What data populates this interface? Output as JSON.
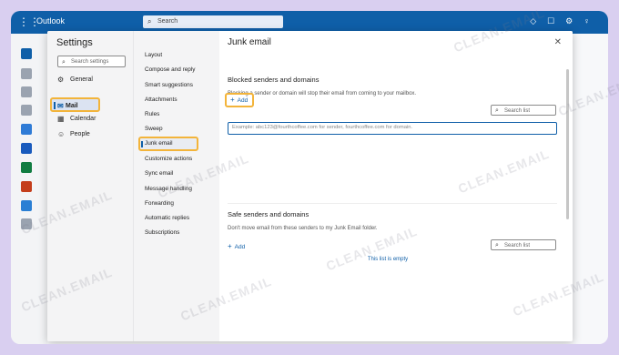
{
  "app": {
    "name": "Outlook",
    "search_placeholder": "Search"
  },
  "settings": {
    "title": "Settings",
    "search_placeholder": "Search settings",
    "categories": [
      {
        "label": "General",
        "icon": "gear-icon"
      },
      {
        "label": "Mail",
        "icon": "mail-icon"
      },
      {
        "label": "Calendar",
        "icon": "calendar-icon"
      },
      {
        "label": "People",
        "icon": "people-icon"
      }
    ],
    "selected_category": "Mail",
    "subcategories": [
      "Layout",
      "Compose and reply",
      "Smart suggestions",
      "Attachments",
      "Rules",
      "Sweep",
      "Junk email",
      "Customize actions",
      "Sync email",
      "Message handling",
      "Forwarding",
      "Automatic replies",
      "Subscriptions"
    ],
    "selected_subcategory": "Junk email"
  },
  "junk": {
    "title": "Junk email",
    "blocked": {
      "title": "Blocked senders and domains",
      "description": "Blocking a sender or domain will stop their email from coming to your mailbox.",
      "add_label": "Add",
      "search_placeholder": "Search list",
      "input_placeholder": "Example: abc123@fourthcoffee.com for sender, fourthcoffee.com for domain."
    },
    "safe": {
      "title": "Safe senders and domains",
      "description": "Don't move email from these senders to my Junk Email folder.",
      "add_label": "Add",
      "search_placeholder": "Search list",
      "empty_text": "This list is empty"
    }
  },
  "watermark": "CLEAN.EMAIL",
  "colors": {
    "accent": "#0f5fa8",
    "highlight": "#f3b43a",
    "backdrop": "#d9cff0"
  }
}
